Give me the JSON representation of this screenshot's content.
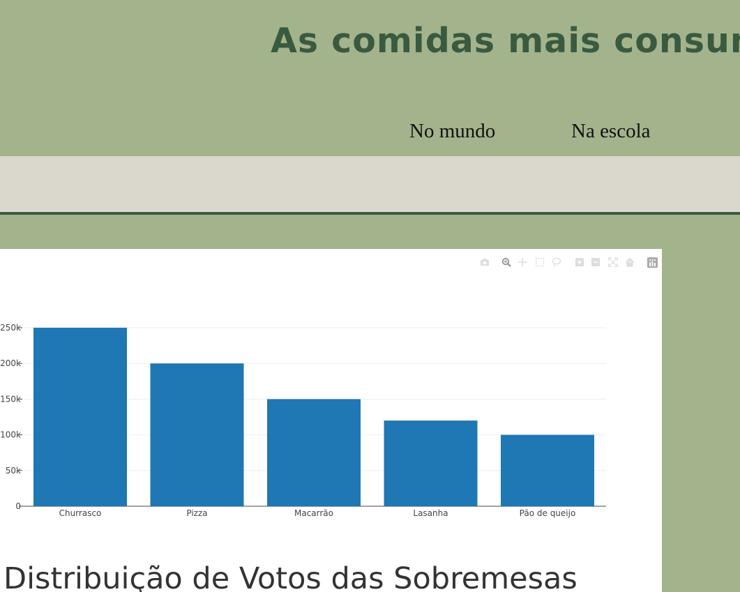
{
  "header": {
    "title": "As comidas mais consumidas",
    "nav": [
      {
        "label": "No mundo"
      },
      {
        "label": "Na escola"
      }
    ]
  },
  "chart_title": "Distribuição de Votos das Sobremesas",
  "modebar": {
    "icons": [
      "camera-icon",
      "zoom-icon",
      "pan-icon",
      "box-select-icon",
      "lasso-icon",
      "zoom-in-icon",
      "zoom-out-icon",
      "autoscale-icon",
      "reset-axes-icon",
      "plotly-logo-icon"
    ]
  },
  "colors": {
    "header_bg": "#a3b38c",
    "title": "#3a5a40",
    "band": "#dad8cd",
    "bar": "#1f77b4"
  },
  "chart_data": {
    "type": "bar",
    "categories": [
      "Churrasco",
      "Pizza",
      "Macarrão",
      "Lasanha",
      "Pão de queijo"
    ],
    "values": [
      250000,
      200000,
      150000,
      120000,
      100000
    ],
    "yticks": [
      0,
      50000,
      100000,
      150000,
      200000,
      250000
    ],
    "ytick_labels": [
      "0",
      "50k",
      "100k",
      "150k",
      "200k",
      "250k"
    ],
    "ylim": [
      0,
      250000
    ],
    "grid": true,
    "title": "",
    "xlabel": "",
    "ylabel": ""
  }
}
